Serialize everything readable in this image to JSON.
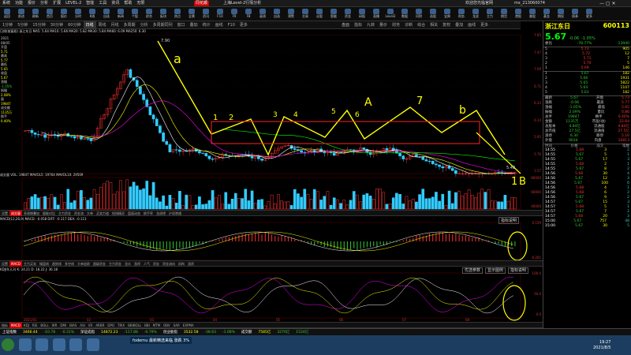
{
  "window": {
    "menus": [
      "系统",
      "功能",
      "报价",
      "分析",
      "扩展",
      "LEVEL-2",
      "智能",
      "工具",
      "资讯",
      "帮助",
      "无限"
    ],
    "center_title": "上海Level-2行情分析",
    "right_info": "欢迎您光临官网",
    "user": "mx_213060074",
    "brand": "同花顺"
  },
  "toolbar": {
    "buttons": [
      "返回",
      "前进",
      "刷新",
      "首页",
      "报价",
      "分时",
      "K线",
      "自选",
      "新闻",
      "个股",
      "综合",
      "板块",
      "热点",
      "全景",
      "资讯",
      "F10",
      "F9",
      "F8",
      "画线",
      "自选",
      "预警",
      "交易",
      "论股",
      "智能",
      "资金",
      "研报",
      "直播",
      "Level2",
      "数据",
      "问财",
      "选股",
      "宝典",
      "财务",
      "龙虎",
      "主力",
      "期货",
      "港股",
      "美股",
      "基金",
      "期权",
      "债券",
      "更多"
    ]
  },
  "tabs": [
    "1分钟",
    "5分钟",
    "15分钟",
    "30分钟",
    "60分钟",
    "日线",
    "周线",
    "月线",
    "多周期",
    "分析",
    "多周期同列",
    "窗口",
    "叠加",
    "统计",
    "画线",
    "F10",
    "更多"
  ],
  "tabs_right": [
    "盘面",
    "指标",
    "九转",
    "量价",
    "财务",
    "诊断",
    "综合",
    "相关",
    "复权",
    "叠加",
    "画线",
    "更多"
  ],
  "main_chart": {
    "legend": "日线(前复权) 浙江东日  MA5: 5.64  MA10: 5.66  MA20: 5.82  MA30: 5.84  MA60: 6.09  MA250: 6.30",
    "y_labels": [
      "7.85",
      "7.47",
      "7.09",
      "6.71",
      "6.33",
      "6.14",
      "5.95",
      "5.76",
      "5.57"
    ],
    "high_label": "7.90",
    "low_label": "5.48",
    "annotations": [
      "a",
      "1",
      "2",
      "3",
      "4",
      "5",
      "6",
      "A",
      "7",
      "b",
      "1",
      "B"
    ],
    "left_info": {
      "date": "2021",
      "date2": "08/05",
      "items": [
        [
          "开盘",
          "5.71"
        ],
        [
          "最高",
          "5.77"
        ],
        [
          "最低",
          "5.65"
        ],
        [
          "收盘",
          "5.67"
        ],
        [
          "涨幅",
          "-1.05%"
        ],
        [
          "振幅",
          "2.08%"
        ],
        [
          "量",
          "19847"
        ],
        [
          "成交额",
          "1135万"
        ],
        [
          "换手",
          "0.40%"
        ]
      ]
    }
  },
  "volume_panel": {
    "legend": "成交量 VOL: 19847  MAVOL5: 19764  MAVOL10: 29509",
    "y_labels": [
      "80000",
      "60000",
      "40000"
    ]
  },
  "sub_tabs_1": [
    "设置",
    "成交量",
    "多周期叠加",
    "量能对比",
    "主力资金",
    "资金流",
    "大单",
    "买卖力道",
    "短线精灵",
    "盘面动态",
    "换手率",
    "龙虎榜",
    "沪深港通"
  ],
  "macd_panel": {
    "legend": "MACD(12,26,9)  MACD: -0.058  DIFF: -0.117  DEA: -0.113",
    "y_labels": [
      "0.159",
      "-0.201"
    ],
    "indicator_button": "指标说明"
  },
  "sub_tabs_2": [
    "设置",
    "MACD",
    "主力买卖",
    "操盘线",
    "趋势线",
    "多空线",
    "大单追踪",
    "超级资金",
    "主力资金",
    "龙头",
    "涨停",
    "人气",
    "资金",
    "资金流向",
    "机构",
    "游资"
  ],
  "kdj_panel": {
    "legend": "KDJ(9,3,3)  K: 24.21  D: 18.22  J: 36.18",
    "buttons": [
      "优选参数",
      "显示图例",
      "指标说明"
    ],
    "y_labels": [
      "100.0",
      "50.0",
      "0.0"
    ]
  },
  "bottom_indicators": [
    "指标",
    "MACD",
    "KDJ",
    "RSI",
    "BOLL",
    "WR",
    "DMI",
    "BIAS",
    "ASI",
    "VR",
    "ARBR",
    "DPO",
    "TRIX",
    "BBIBOLL",
    "BBI",
    "MTM",
    "OBV",
    "SAR",
    "EXPMA"
  ],
  "x_dates": [
    "2021/01",
    "02",
    "03",
    "04",
    "05",
    "06",
    "07",
    "08"
  ],
  "right_panel": {
    "code": "600113",
    "name": "浙江东日",
    "price": "5.67",
    "change": "-0.06",
    "pct": "-1.05%",
    "commission_label": "委比",
    "commission_value": "-78.77%",
    "commission_diff": "-13940",
    "sell": [
      [
        "5",
        "5.73",
        "905"
      ],
      [
        "4",
        "5.72",
        "12"
      ],
      [
        "3",
        "5.71",
        "7"
      ],
      [
        "2",
        "5.70",
        "5"
      ],
      [
        "1",
        "5.69",
        "146"
      ]
    ],
    "buy": [
      [
        "1",
        "5.67",
        "182"
      ],
      [
        "2",
        "5.66",
        "1931"
      ],
      [
        "3",
        "5.65",
        "5822"
      ],
      [
        "4",
        "5.64",
        "1107"
      ],
      [
        "5",
        "5.63",
        "182"
      ]
    ],
    "stats": [
      [
        "最新",
        "5.67",
        "开盘",
        "5.73"
      ],
      [
        "涨跌",
        "-0.06",
        "最高",
        "5.77"
      ],
      [
        "涨幅",
        "-1.05%",
        "最低",
        "5.65"
      ],
      [
        "振幅",
        "2.09%",
        "量比",
        "0.86"
      ],
      [
        "总手",
        "19847",
        "换手",
        "0.40%"
      ],
      [
        "金额",
        "1135万",
        "市盈(动)",
        "22.64"
      ],
      [
        "总股本",
        "4.84亿",
        "流通股",
        "4.84亿"
      ],
      [
        "总市值",
        "27.5亿",
        "流通值",
        "27.5亿"
      ],
      [
        "涨停",
        "6.30",
        "跌停",
        "5.16"
      ],
      [
        "外盘",
        "9034",
        "内盘",
        "10813"
      ]
    ],
    "ticks_header": [
      "时间",
      "价格",
      "成交",
      "笔数"
    ],
    "ticks": [
      [
        "14:55",
        "5.68",
        "3",
        "2"
      ],
      [
        "14:55",
        "5.67",
        "5",
        "1"
      ],
      [
        "14:55",
        "5.67",
        "17",
        "3"
      ],
      [
        "14:55",
        "5.68",
        "2",
        "1"
      ],
      [
        "14:55",
        "5.67",
        "8",
        "2"
      ],
      [
        "14:56",
        "5.68",
        "30",
        "4"
      ],
      [
        "14:56",
        "5.67",
        "12",
        "3"
      ],
      [
        "14:56",
        "5.67",
        "100",
        "6"
      ],
      [
        "14:56",
        "5.68",
        "4",
        "1"
      ],
      [
        "14:56",
        "5.68",
        "6",
        "2"
      ],
      [
        "14:56",
        "5.67",
        "9",
        "2"
      ],
      [
        "14:57",
        "5.67",
        "15",
        "3"
      ],
      [
        "14:57",
        "5.68",
        "5",
        "1"
      ],
      [
        "14:57",
        "5.67",
        "7",
        "2"
      ],
      [
        "14:57",
        "5.68",
        "20",
        "3"
      ],
      [
        "15:00",
        "5.67",
        "757",
        "48"
      ],
      [
        "15:00",
        "5.67",
        "30",
        "5"
      ]
    ]
  },
  "statusbar": {
    "items": [
      [
        "上证指数",
        "3466.44",
        "-10.78",
        "-0.31%"
      ],
      [
        "深证成指",
        "14872.23",
        "-117.88",
        "-0.79%"
      ],
      [
        "创业板指",
        "3532.58",
        "-38.63",
        "-1.08%"
      ],
      [
        "成交额",
        "7585亿",
        "3270亿",
        "1524亿"
      ]
    ]
  },
  "taskbar": {
    "start": "开始",
    "ticker": "fodernu 最新精选来临 涨跌 3%",
    "time": "19:27",
    "date": "2021/8/5"
  }
}
